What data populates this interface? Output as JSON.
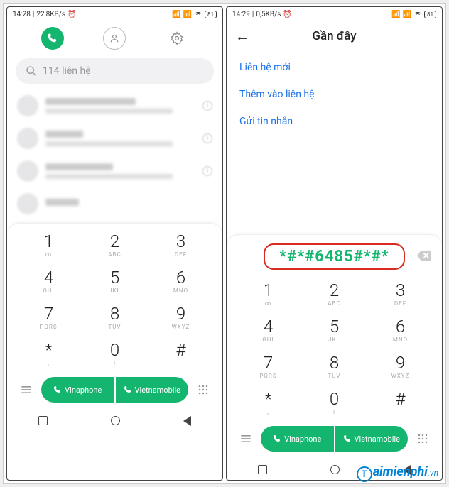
{
  "left": {
    "status": {
      "time": "14:28",
      "net": "22,8KB/s",
      "battery": "81"
    },
    "search_placeholder": "114 liên hệ",
    "sim1": "Vinaphone",
    "sim2": "Vietnamobile"
  },
  "right": {
    "status": {
      "time": "14:29",
      "net": "0,5KB/s",
      "battery": "81"
    },
    "title": "Gần đây",
    "actions": {
      "new_contact": "Liên hệ mới",
      "add_to_contact": "Thêm vào liên hệ",
      "send_sms": "Gửi tin nhắn"
    },
    "dialed": "*#*#6485#*#*",
    "sim1": "Vinaphone",
    "sim2": "Vietnamobile"
  },
  "keypad": [
    {
      "d": "1",
      "l": "∞"
    },
    {
      "d": "2",
      "l": "ABC"
    },
    {
      "d": "3",
      "l": "DEF"
    },
    {
      "d": "4",
      "l": "GHI"
    },
    {
      "d": "5",
      "l": "JKL"
    },
    {
      "d": "6",
      "l": "MNO"
    },
    {
      "d": "7",
      "l": "PQRS"
    },
    {
      "d": "8",
      "l": "TUV"
    },
    {
      "d": "9",
      "l": "WXYZ"
    },
    {
      "d": "*",
      "l": ","
    },
    {
      "d": "0",
      "l": "+"
    },
    {
      "d": "#",
      "l": ""
    }
  ],
  "watermark": {
    "letter": "T",
    "text": "aimienphi",
    "suffix": ".vn"
  }
}
